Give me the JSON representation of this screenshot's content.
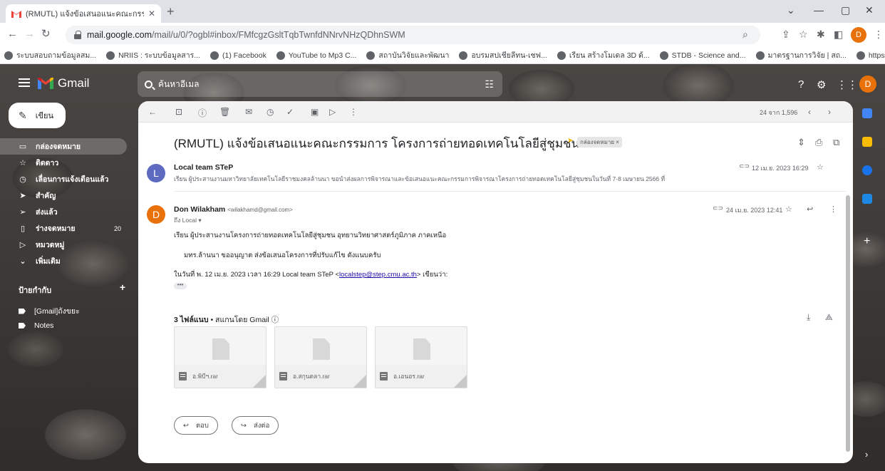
{
  "browser": {
    "tab_title": "(RMUTL) แจ้งข้อเสนอแนะคณะกรรมก",
    "url_host": "mail.google.com",
    "url_path": "/mail/u/0/?ogbl#inbox/FMfcgzGsltTqbTwnfdNNrvNHzQDhnSWM",
    "profile_initial": "D",
    "bookmarks": [
      "ระบบสอบถามข้อมูลสม...",
      "NRIIS : ระบบข้อมูลสาร...",
      "(1) Facebook",
      "YouTube to Mp3 C...",
      "สถาบันวิจัยและพัฒนา",
      "อบรมสปเชียลีทน-เชฟ...",
      "เรียน สร้างโมเดล 3D ด้...",
      "STDB - Science and...",
      "มาตรฐานการวิจัย | สถ...",
      "https://www.cmcoo..."
    ]
  },
  "gmail": {
    "brand": "Gmail",
    "search_placeholder": "ค้นหาอีเมล",
    "compose_label": "เขียน",
    "profile_initial": "D",
    "sidebar": [
      {
        "label": "กล่องจดหมาย",
        "icon": "inbox-icon",
        "active": true
      },
      {
        "label": "ติดดาว",
        "icon": "star-icon"
      },
      {
        "label": "เลื่อนการแจ้งเตือนแล้ว",
        "icon": "clock-icon"
      },
      {
        "label": "สำคัญ",
        "icon": "important-icon"
      },
      {
        "label": "ส่งแล้ว",
        "icon": "send-icon"
      },
      {
        "label": "ร่างจดหมาย",
        "icon": "draft-icon",
        "count": "20"
      },
      {
        "label": "หมวดหมู่",
        "icon": "category-icon"
      },
      {
        "label": "เพิ่มเติม",
        "icon": "chevron-down-icon"
      }
    ],
    "labels_header": "ป้ายกำกับ",
    "labels": [
      "[Gmail]ถังขยะ",
      "Notes"
    ]
  },
  "thread": {
    "pagination": "24 จาก 1,596",
    "subject": "(RMUTL) แจ้งข้อเสนอแนะคณะกรรมการ โครงการถ่ายทอดเทคโนโลยีสู่ชุมชน 2566",
    "inbox_chip": "กล่องจดหมาย ×",
    "messages": [
      {
        "initial": "L",
        "sender": "Local team STeP",
        "snippet": "เรียน ผู้ประสานงานมหาวิทยาลัยเทคโนโลยีราชมงคลล้านนา ขอนำส่งผลการพิจารณาและข้อเสนอแนะคณะกรรมการพิจารณาโครงการถ่ายทอดเทคโนโลยีสู่ชุมชนในวันที่ 7-8 เมษายน 2566 ที่",
        "date": "12 เม.ย. 2023 16:29"
      },
      {
        "initial": "D",
        "sender": "Don Wilakham",
        "email": "<wilakhamd@gmail.com>",
        "to": "ถึง Local ▾",
        "date": "24 เม.ย. 2023 12:41",
        "body_line1": "เรียน ผู้ประสานงานโครงการถ่ายทอดเทคโนโลยีสู่ชุมชน อุทยานวิทยาศาสตร์ภูมิภาค ภาคเหนือ",
        "body_line2": "มทร.ล้านนา ขออนุญาต ส่งข้อเสนอโครงการที่ปรับแก้ไข ดังแนบครับ",
        "quote_prefix": "ในวันที่ พ. 12 เม.ย. 2023 เวลา 16:29 Local team STeP <",
        "quote_link": "localstep@step.cmu.ac.th",
        "quote_suffix": "> เขียนว่า:",
        "dots": "•••"
      }
    ],
    "attachments_header": "3 ไฟล์แนบ",
    "attachments_scanned": " • สแกนโดย Gmail ⓘ",
    "attachments": [
      "อ.พิบีฯ.rar",
      "อ.สกุนดลา.rar",
      "อ.เอนอร.rar"
    ],
    "reply_label": "ตอบ",
    "forward_label": "ส่งต่อ"
  }
}
